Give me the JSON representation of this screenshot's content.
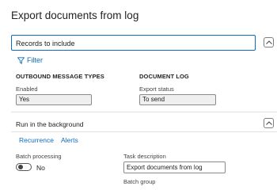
{
  "page": {
    "title": "Export documents from log"
  },
  "records": {
    "label": "Records to include",
    "filter_label": "Filter"
  },
  "outbound": {
    "heading": "OUTBOUND MESSAGE TYPES",
    "enabled_label": "Enabled",
    "enabled_value": "Yes"
  },
  "document_log": {
    "heading": "DOCUMENT LOG",
    "export_status_label": "Export status",
    "export_status_value": "To send"
  },
  "background": {
    "label": "Run in the background",
    "links": [
      "Recurrence",
      "Alerts"
    ],
    "batch_processing_label": "Batch processing",
    "batch_processing_value": "No",
    "task_description_label": "Task description",
    "task_description_value": "Export documents from log",
    "batch_group_label": "Batch group"
  },
  "icons": {
    "collapse": "chevron-up-icon",
    "filter": "filter-icon"
  },
  "colors": {
    "accent": "#0f6cbd"
  }
}
